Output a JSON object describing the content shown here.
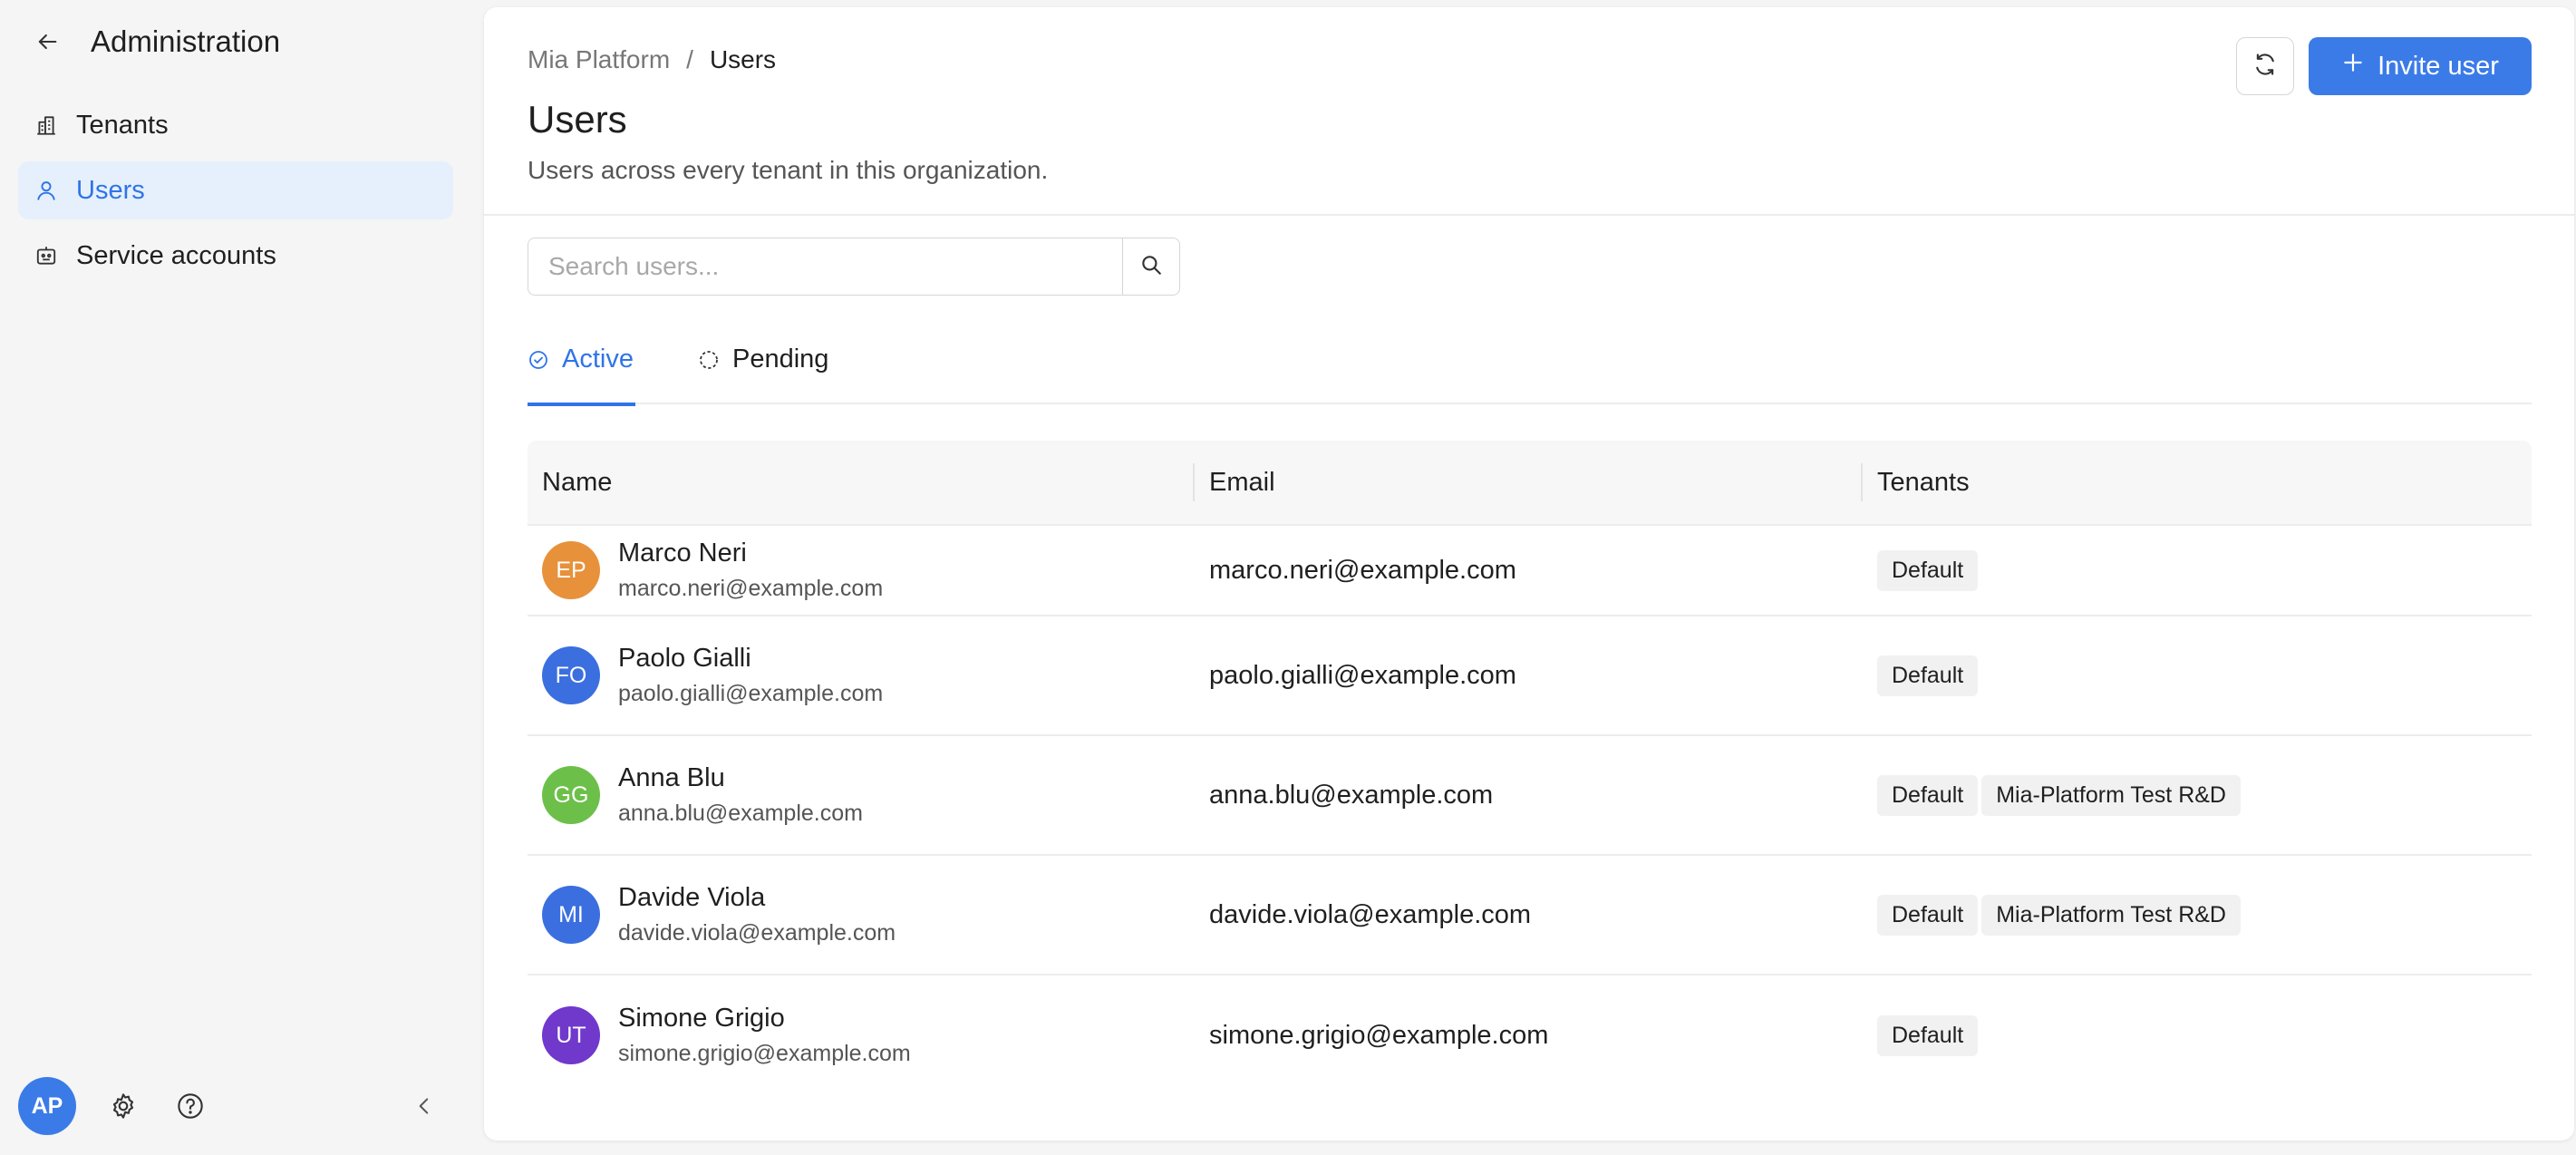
{
  "sidebar": {
    "title": "Administration",
    "items": [
      {
        "label": "Tenants",
        "icon": "building-icon"
      },
      {
        "label": "Users",
        "icon": "user-icon",
        "active": true
      },
      {
        "label": "Service accounts",
        "icon": "robot-icon"
      }
    ],
    "footer": {
      "avatar_initials": "AP"
    }
  },
  "header": {
    "breadcrumb_root": "Mia Platform",
    "breadcrumb_sep": "/",
    "breadcrumb_current": "Users",
    "title": "Users",
    "subtitle": "Users across every tenant in this organization.",
    "invite_label": "Invite user"
  },
  "search": {
    "placeholder": "Search users...",
    "value": ""
  },
  "tabs": [
    {
      "label": "Active",
      "active": true
    },
    {
      "label": "Pending",
      "active": false
    }
  ],
  "table": {
    "columns": [
      "Name",
      "Email",
      "Tenants"
    ],
    "rows": [
      {
        "initials": "EP",
        "color": "#e8913b",
        "name": "Marco Neri",
        "sub": "marco.neri@example.com",
        "email": "marco.neri@example.com",
        "tenants": [
          "Default"
        ]
      },
      {
        "initials": "FO",
        "color": "#3b6fe0",
        "name": "Paolo Gialli",
        "sub": "paolo.gialli@example.com",
        "email": "paolo.gialli@example.com",
        "tenants": [
          "Default"
        ]
      },
      {
        "initials": "GG",
        "color": "#6cc04a",
        "name": "Anna Blu",
        "sub": "anna.blu@example.com",
        "email": "anna.blu@example.com",
        "tenants": [
          "Default",
          "Mia-Platform Test R&D"
        ]
      },
      {
        "initials": "MI",
        "color": "#3b6fe0",
        "name": "Davide Viola",
        "sub": "davide.viola@example.com",
        "email": "davide.viola@example.com",
        "tenants": [
          "Default",
          "Mia-Platform Test R&D"
        ]
      },
      {
        "initials": "UT",
        "color": "#7138cc",
        "name": "Simone Grigio",
        "sub": "simone.grigio@example.com",
        "email": "simone.grigio@example.com",
        "tenants": [
          "Default"
        ]
      }
    ]
  },
  "colors": {
    "accent": "#3b7be8",
    "active_bg": "#e6f0fc"
  }
}
